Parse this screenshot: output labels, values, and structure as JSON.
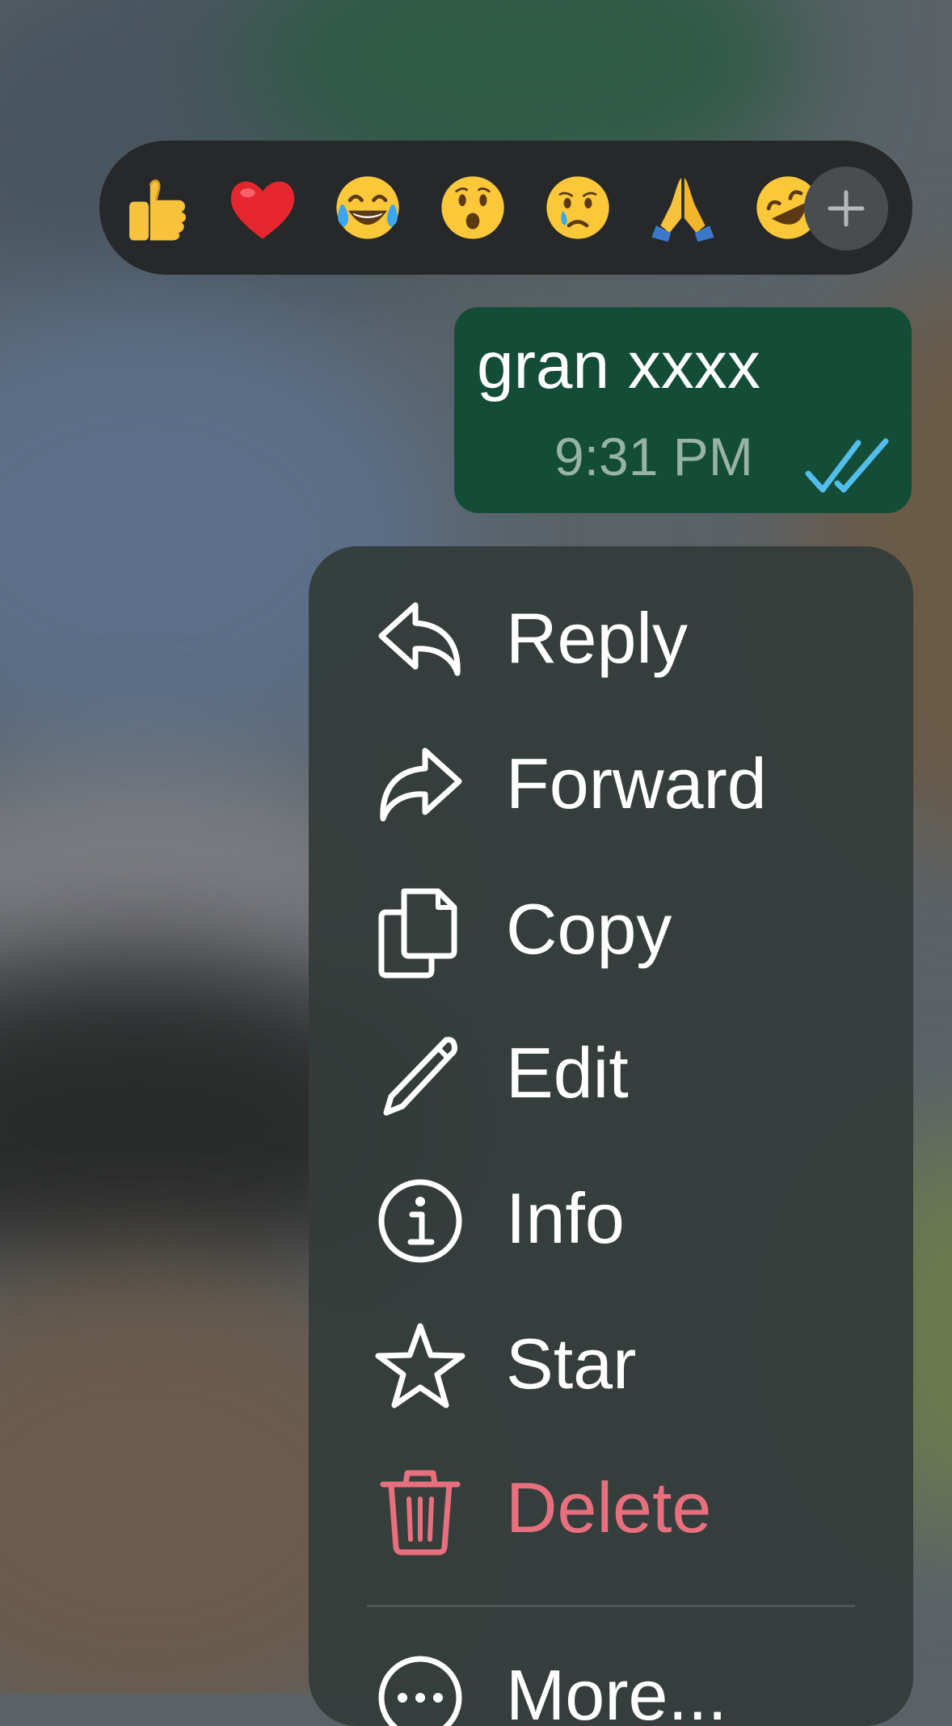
{
  "reactions": {
    "emojis": [
      {
        "name": "thumbs-up",
        "glyph": "👍"
      },
      {
        "name": "red-heart",
        "glyph": "❤️"
      },
      {
        "name": "tears-of-joy",
        "glyph": "😂"
      },
      {
        "name": "surprised",
        "glyph": "😮"
      },
      {
        "name": "crying",
        "glyph": "😢"
      },
      {
        "name": "folded-hands",
        "glyph": "🙏"
      },
      {
        "name": "rolling-on-floor-laughing",
        "glyph": "🤣"
      }
    ],
    "more_icon": "plus-icon"
  },
  "message": {
    "text": "gran xxxx",
    "time": "9:31 PM",
    "status_icon": "double-check-read-icon",
    "status_color": "#53bdeb"
  },
  "menu": {
    "items": [
      {
        "label": "Reply",
        "icon": "reply-icon"
      },
      {
        "label": "Forward",
        "icon": "forward-icon"
      },
      {
        "label": "Copy",
        "icon": "copy-icon"
      },
      {
        "label": "Edit",
        "icon": "pencil-icon"
      },
      {
        "label": "Info",
        "icon": "info-icon"
      },
      {
        "label": "Star",
        "icon": "star-icon"
      },
      {
        "label": "Delete",
        "icon": "trash-icon",
        "color": "#e8707e"
      },
      {
        "label": "More...",
        "icon": "more-icon"
      }
    ]
  },
  "colors": {
    "bubble": "#144d37",
    "menu": "#343c3a",
    "danger": "#e8707e"
  }
}
